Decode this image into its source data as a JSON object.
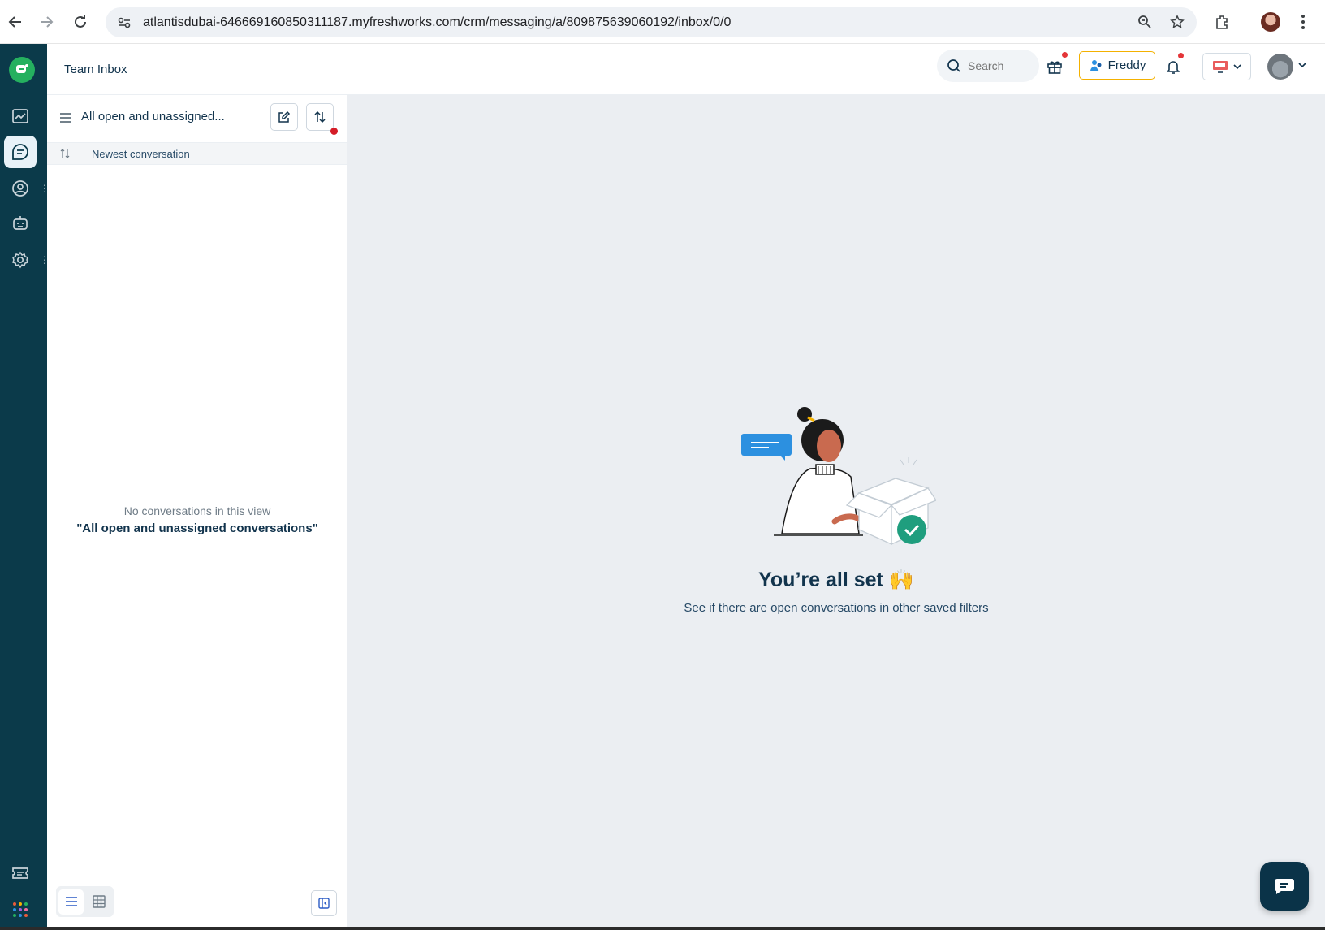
{
  "browser": {
    "url": "atlantisdubai-646669160850311187.myfreshworks.com/crm/messaging/a/809875639060192/inbox/0/0"
  },
  "header": {
    "title": "Team Inbox",
    "search_placeholder": "Search",
    "freddy_label": "Freddy"
  },
  "list_panel": {
    "view_title": "All open and unassigned...",
    "sort_label": "Newest conversation",
    "empty_line1": "No conversations in this view",
    "empty_line2": "\"All open and unassigned conversations\""
  },
  "main": {
    "title": "You’re all set 🙌",
    "subtitle": "See if there are open conversations in other saved filters"
  },
  "colors": {
    "nav_bg": "#0b3a4a",
    "accent_green": "#25b05f",
    "main_bg": "#ebeef2",
    "freddy_border": "#f4b100",
    "notification_red": "#e43538"
  },
  "icons": {
    "left_nav": [
      "freshchat-logo-icon",
      "dashboard-icon",
      "conversations-icon",
      "contacts-icon",
      "bot-icon",
      "settings-icon",
      "tickets-icon",
      "apps-grid-icon"
    ],
    "header": [
      "search-icon",
      "gift-icon",
      "freddy-icon",
      "bell-icon",
      "status-icon",
      "chevron-down-icon"
    ]
  }
}
